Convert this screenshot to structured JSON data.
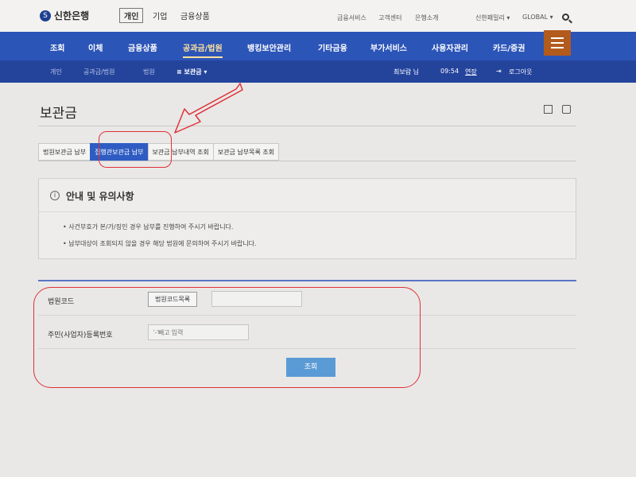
{
  "header": {
    "logo_text": "신한은행",
    "segments": [
      "개인",
      "기업",
      "금융상품"
    ],
    "utility_links": [
      "금융서비스",
      "고객센터",
      "은행소개"
    ],
    "family_site": "신한패밀리 ▾",
    "global": "GLOBAL ▾"
  },
  "main_nav": {
    "items": [
      "조회",
      "이체",
      "금융상품",
      "공과금/법원",
      "뱅킹보안관리",
      "기타금융",
      "부가서비스",
      "사용자관리",
      "카드/증권"
    ],
    "active_index": 3
  },
  "sub_nav": {
    "breadcrumbs": [
      "개인",
      "공과금/법원",
      "법원"
    ],
    "current": "≡ 보관금 ▾",
    "user": "최보람 님",
    "time": "09:54",
    "extend": "연장",
    "logout": "로그아웃"
  },
  "page": {
    "title": "보관금"
  },
  "tabs": {
    "items": [
      "법원보관금 납부",
      "집행관보관금 납부",
      "보관금 납부내역 조회",
      "보관금 납부목록 조회"
    ],
    "active_index": 1
  },
  "notice": {
    "title": "안내 및 유의사항",
    "bullets": [
      "사건부호가 본/가/징인 경우 납부를 진행하여 주시기 바랍니다.",
      "납부대상이 조회되지 않을 경우 해당 법원에 문의하여 주시기 바랍니다."
    ]
  },
  "form": {
    "court_code_label": "법원코드",
    "court_code_button": "법원코드목록",
    "court_code_value": "",
    "reg_no_label": "주민(사업자)등록번호",
    "reg_no_placeholder": "'-'빼고 입력",
    "submit_label": "조회"
  },
  "colors": {
    "nav_blue": "#2c55b8",
    "subnav_blue": "#24449c",
    "tab_active": "#2f5cc2",
    "submit_button": "#5b9bd5",
    "annotation_red": "#e0303a",
    "menu_orange": "#b35a1d"
  }
}
